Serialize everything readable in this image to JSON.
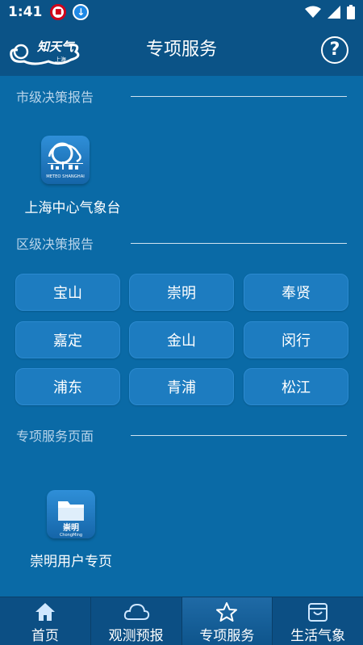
{
  "status": {
    "time": "1:41",
    "left_icons": [
      "carrier-icon",
      "download-icon"
    ],
    "right_icons": [
      "wifi-icon",
      "signal-icon",
      "battery-icon"
    ]
  },
  "appbar": {
    "logo_text": "知天气",
    "logo_sub": "上海",
    "title": "专项服务",
    "help": "?"
  },
  "city_section": {
    "label": "市级决策报告",
    "app": {
      "label": "上海中心气象台",
      "icon_caption": "METEO SHANGHAI"
    }
  },
  "district_section": {
    "label": "区级决策报告",
    "districts": [
      "宝山",
      "崇明",
      "奉贤",
      "嘉定",
      "金山",
      "闵行",
      "浦东",
      "青浦",
      "松江"
    ]
  },
  "page_section": {
    "label": "专项服务页面",
    "app": {
      "label": "崇明用户专页",
      "icon_caption": "崇明",
      "icon_sub": "ChongMing"
    }
  },
  "bottom_nav": [
    {
      "label": "首页",
      "icon": "home-icon",
      "active": false
    },
    {
      "label": "观测预报",
      "icon": "cloud-icon",
      "active": false
    },
    {
      "label": "专项服务",
      "icon": "star-icon",
      "active": true
    },
    {
      "label": "生活气象",
      "icon": "bag-icon",
      "active": false
    }
  ]
}
